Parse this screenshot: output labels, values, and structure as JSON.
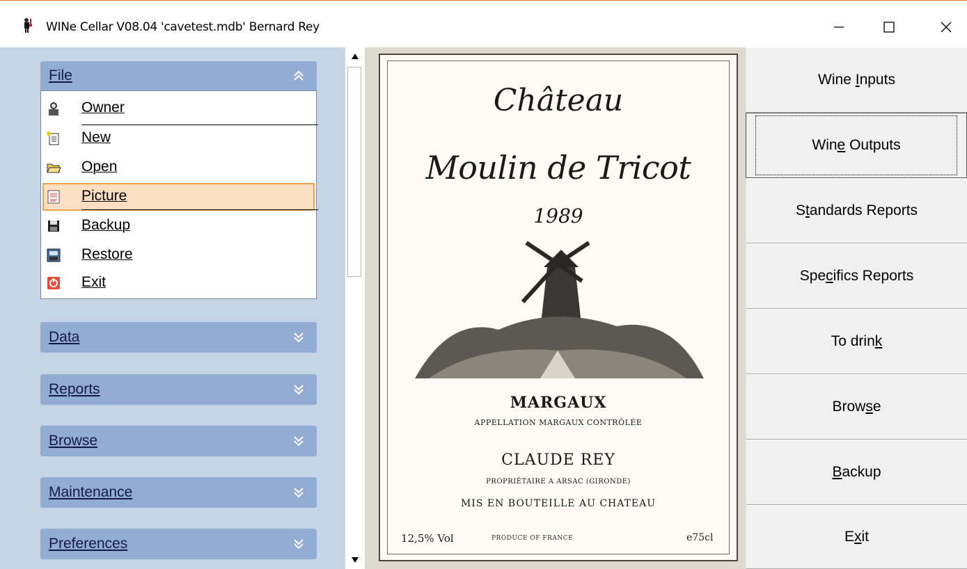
{
  "window": {
    "title": "WINe Cellar V08.04  'cavetest.mdb'  Bernard Rey",
    "icon": "wine-waiter-icon",
    "controls": [
      "minimize",
      "maximize",
      "close"
    ]
  },
  "sidebar": {
    "file_group": {
      "label": "File",
      "expanded": true,
      "items": [
        {
          "label": "Owner",
          "icon": "owner-icon"
        },
        {
          "label": "New",
          "icon": "new-document-icon"
        },
        {
          "label": "Open",
          "icon": "open-folder-icon"
        },
        {
          "label": "Picture",
          "icon": "picture-icon",
          "selected": true
        },
        {
          "label": "Backup",
          "icon": "floppy-disk-icon"
        },
        {
          "label": "Restore",
          "icon": "restore-icon"
        },
        {
          "label": "Exit",
          "icon": "exit-icon"
        }
      ]
    },
    "groups": [
      {
        "label": "Data"
      },
      {
        "label": "Reports"
      },
      {
        "label": "Browse"
      },
      {
        "label": "Maintenance"
      },
      {
        "label": "Preferences"
      }
    ]
  },
  "wine_label": {
    "line1": "Château",
    "line2": "Moulin de Tricot",
    "vintage": "1989",
    "appellation_title": "MARGAUX",
    "appellation_sub": "APPELLATION MARGAUX CONTRÔLÉE",
    "producer": "CLAUDE REY",
    "producer_sub": "PROPRIÉTAIRE A ARSAC (GIRONDE)",
    "bottled": "MIS EN BOUTEILLE AU CHATEAU",
    "alcohol": "12,5% Vol",
    "origin": "PRODUCE OF FRANCE",
    "volume": "e75cl"
  },
  "actions": {
    "buttons": [
      {
        "pre": "Wine ",
        "key": "I",
        "post": "nputs",
        "focused": false
      },
      {
        "pre": "Win",
        "key": "e",
        "post": " Outputs",
        "focused": true
      },
      {
        "pre": "S",
        "key": "t",
        "post": "andards Reports",
        "focused": false
      },
      {
        "pre": "Spe",
        "key": "c",
        "post": "ifics Reports",
        "focused": false
      },
      {
        "pre": "To drin",
        "key": "k",
        "post": "",
        "focused": false
      },
      {
        "pre": "Brow",
        "key": "s",
        "post": "e",
        "focused": false
      },
      {
        "pre": "",
        "key": "B",
        "post": "ackup",
        "focused": false
      },
      {
        "pre": "E",
        "key": "x",
        "post": "it",
        "focused": false
      }
    ]
  },
  "colors": {
    "sidebar_bg": "#c6d5e6",
    "group_header": "#93acd4",
    "selection_bg": "#fbdfc3",
    "selection_border": "#f0a24c",
    "button_face": "#f0f0f0"
  }
}
